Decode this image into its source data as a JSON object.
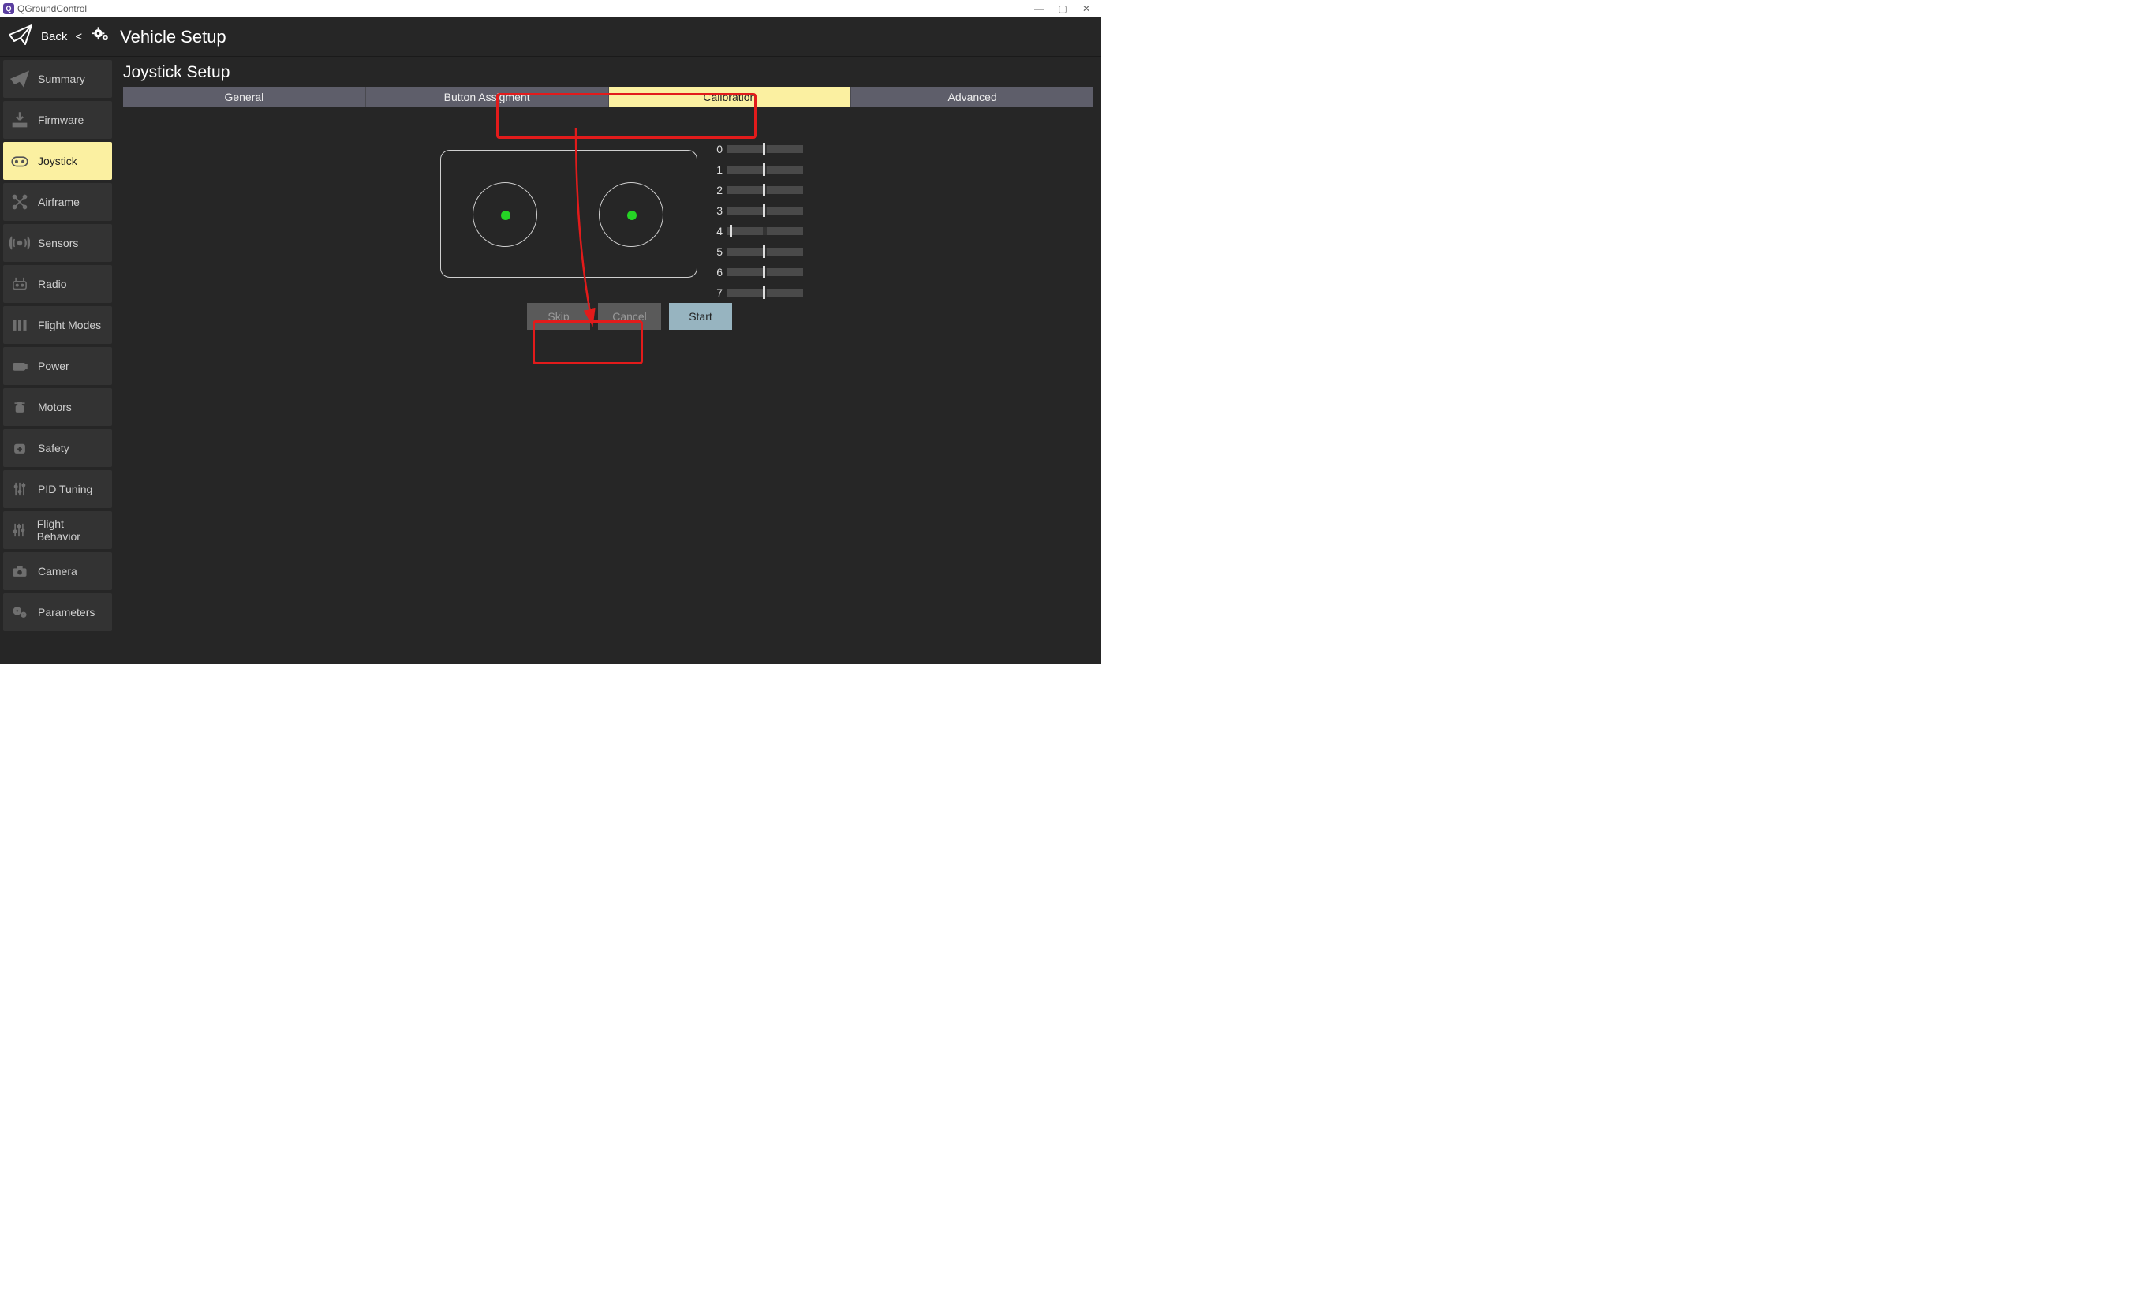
{
  "window": {
    "title": "QGroundControl"
  },
  "topbar": {
    "back": "Back",
    "title": "Vehicle Setup"
  },
  "sidebar": {
    "items": [
      {
        "label": "Summary"
      },
      {
        "label": "Firmware"
      },
      {
        "label": "Joystick"
      },
      {
        "label": "Airframe"
      },
      {
        "label": "Sensors"
      },
      {
        "label": "Radio"
      },
      {
        "label": "Flight Modes"
      },
      {
        "label": "Power"
      },
      {
        "label": "Motors"
      },
      {
        "label": "Safety"
      },
      {
        "label": "PID Tuning"
      },
      {
        "label": "Flight Behavior"
      },
      {
        "label": "Camera"
      },
      {
        "label": "Parameters"
      }
    ]
  },
  "page": {
    "title": "Joystick Setup",
    "tabs": [
      {
        "label": "General"
      },
      {
        "label": "Button Assigment"
      },
      {
        "label": "Calibration"
      },
      {
        "label": "Advanced"
      }
    ],
    "channels": [
      {
        "n": "0"
      },
      {
        "n": "1"
      },
      {
        "n": "2"
      },
      {
        "n": "3"
      },
      {
        "n": "4"
      },
      {
        "n": "5"
      },
      {
        "n": "6"
      },
      {
        "n": "7"
      }
    ],
    "buttons": {
      "skip": "Skip",
      "cancel": "Cancel",
      "start": "Start"
    }
  }
}
